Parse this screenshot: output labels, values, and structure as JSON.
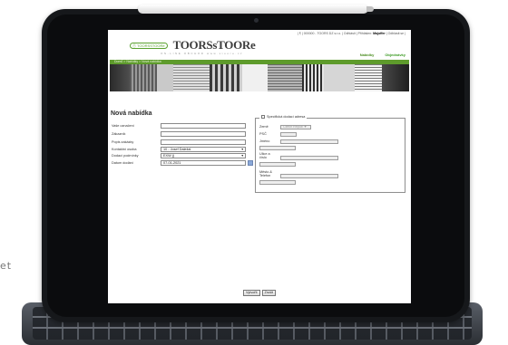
{
  "side_text": "et",
  "site": {
    "top_links": [
      "| ¶ | 000000 - TOORS DZ s.r.o. | Odhlásit | Přihlášen: ",
      "Majoffer",
      " | Odhlásit se |"
    ],
    "badge": "Ⓣ TOORSSTOORé",
    "brand": "TOORSsTOORe",
    "tagline": "ON-LINE OBCHOD www.stoore.cz",
    "nav": [
      "Nabídky",
      "Objednávky"
    ],
    "breadcrumb": "Domů > Nabídky > Nová nabídka"
  },
  "colors": {
    "accent_green": "#5e9b2c",
    "nav_green": "#4a8c1f"
  },
  "form": {
    "title": "Nová nabídka",
    "fields": [
      {
        "label": "Vaše označení",
        "value": ""
      },
      {
        "label": "Zákazník",
        "value": ""
      },
      {
        "label": "Popis zakázky",
        "value": ""
      },
      {
        "label": "Kontaktní osoba",
        "value": "10 - Josef Daležal"
      },
      {
        "label": "Dodací podmínky",
        "value": "EXW ()"
      },
      {
        "label": "Datum dodání",
        "value": "07-01-2021"
      }
    ]
  },
  "delivery": {
    "legend": "Specifická dodací adresa",
    "country_label": "Země",
    "country_value": "Czech Repub",
    "zip_label": "PSČ",
    "name_label": "Jméno",
    "street_label_1": "Ulice a",
    "street_label_2": "číslo",
    "city_label_1": "Město &",
    "city_label_2": "Telefon"
  },
  "actions": {
    "create": "Vytvořit",
    "cancel": "Zrušit"
  }
}
